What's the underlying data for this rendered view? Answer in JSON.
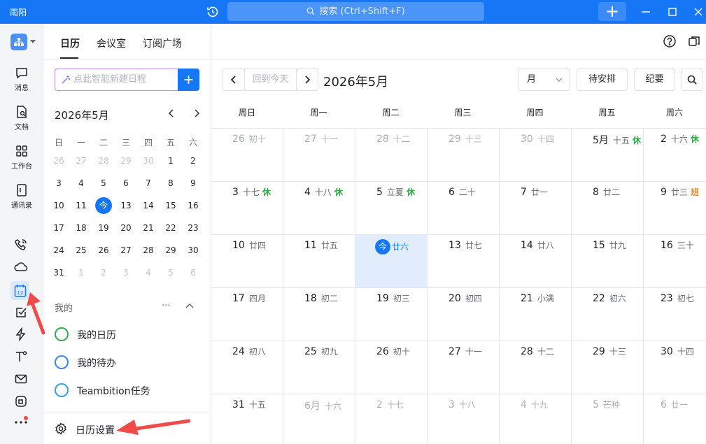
{
  "titlebar": {
    "app_name": "雨阳",
    "search_placeholder": "搜索 (Ctrl+Shift+F)"
  },
  "rail": {
    "items": [
      {
        "label": "消息",
        "icon": "chat-icon"
      },
      {
        "label": "文档",
        "icon": "doc-icon"
      },
      {
        "label": "工作台",
        "icon": "grid-icon"
      },
      {
        "label": "通讯录",
        "icon": "contacts-icon"
      }
    ],
    "calendar_icon_text": "12"
  },
  "tabs": [
    "日历",
    "会议室",
    "订阅广场"
  ],
  "smart_input_placeholder": "点此智能新建日程",
  "mini_calendar": {
    "title": "2026年5月",
    "weekdays": [
      "日",
      "一",
      "二",
      "三",
      "四",
      "五",
      "六"
    ],
    "weeks": [
      [
        "26",
        "27",
        "28",
        "29",
        "30",
        "1",
        "2"
      ],
      [
        "3",
        "4",
        "5",
        "6",
        "7",
        "8",
        "9"
      ],
      [
        "10",
        "11",
        "今",
        "13",
        "14",
        "15",
        "16"
      ],
      [
        "17",
        "18",
        "19",
        "20",
        "21",
        "22",
        "23"
      ],
      [
        "24",
        "25",
        "26",
        "27",
        "28",
        "29",
        "30"
      ],
      [
        "31",
        "1",
        "2",
        "3",
        "4",
        "5",
        "6"
      ]
    ]
  },
  "my_section": {
    "title": "我的",
    "more": "···",
    "calendars": [
      {
        "label": "我的日历",
        "color": "#34a853"
      },
      {
        "label": "我的待办",
        "color": "#3b82f6"
      },
      {
        "label": "Teambition任务",
        "color": "#3b9ddf"
      }
    ]
  },
  "settings_label": "日历设置",
  "toolbar": {
    "back_today": "回到今天",
    "title": "2026年5月",
    "view_select": "月",
    "pending": "待安排",
    "memo": "纪要"
  },
  "month": {
    "weekdays": [
      "周日",
      "周一",
      "周二",
      "周三",
      "周四",
      "周五",
      "周六"
    ],
    "weeks": [
      [
        {
          "n": "26",
          "l": "初十",
          "dim": true
        },
        {
          "n": "27",
          "l": "十一",
          "dim": true
        },
        {
          "n": "28",
          "l": "十二",
          "dim": true
        },
        {
          "n": "29",
          "l": "十三",
          "dim": true
        },
        {
          "n": "30",
          "l": "十四",
          "dim": true
        },
        {
          "n": "5月",
          "l": "十五",
          "tag": "休",
          "tagType": "rest"
        },
        {
          "n": "2",
          "l": "十六",
          "tag": "休",
          "tagType": "rest"
        }
      ],
      [
        {
          "n": "3",
          "l": "十七",
          "tag": "休",
          "tagType": "rest"
        },
        {
          "n": "4",
          "l": "十八",
          "tag": "休",
          "tagType": "rest"
        },
        {
          "n": "5",
          "l": "立夏",
          "tag": "休",
          "tagType": "rest"
        },
        {
          "n": "6",
          "l": "二十"
        },
        {
          "n": "7",
          "l": "廿一"
        },
        {
          "n": "8",
          "l": "廿二"
        },
        {
          "n": "9",
          "l": "廿三",
          "tag": "班",
          "tagType": "work"
        }
      ],
      [
        {
          "n": "10",
          "l": "廿四"
        },
        {
          "n": "11",
          "l": "廿五"
        },
        {
          "n": "今",
          "l": "廿六",
          "today": true
        },
        {
          "n": "13",
          "l": "廿七"
        },
        {
          "n": "14",
          "l": "廿八"
        },
        {
          "n": "15",
          "l": "廿九"
        },
        {
          "n": "16",
          "l": "三十"
        }
      ],
      [
        {
          "n": "17",
          "l": "四月"
        },
        {
          "n": "18",
          "l": "初二"
        },
        {
          "n": "19",
          "l": "初三"
        },
        {
          "n": "20",
          "l": "初四"
        },
        {
          "n": "21",
          "l": "小满"
        },
        {
          "n": "22",
          "l": "初六"
        },
        {
          "n": "23",
          "l": "初七"
        }
      ],
      [
        {
          "n": "24",
          "l": "初八"
        },
        {
          "n": "25",
          "l": "初九"
        },
        {
          "n": "26",
          "l": "初十"
        },
        {
          "n": "27",
          "l": "十一"
        },
        {
          "n": "28",
          "l": "十二"
        },
        {
          "n": "29",
          "l": "十三"
        },
        {
          "n": "30",
          "l": "十四"
        }
      ],
      [
        {
          "n": "31",
          "l": "十五"
        },
        {
          "n": "6月",
          "l": "十六",
          "dim": true
        },
        {
          "n": "2",
          "l": "十七",
          "dim": true
        },
        {
          "n": "3",
          "l": "十八",
          "dim": true
        },
        {
          "n": "4",
          "l": "十九",
          "dim": true
        },
        {
          "n": "5",
          "l": "芒种",
          "dim": true
        },
        {
          "n": "6",
          "l": "廿一",
          "dim": true
        }
      ]
    ]
  },
  "colors": {
    "brand": "#1677f6",
    "rest": "#32a645",
    "work": "#f08a24",
    "annotation": "#f04b4b"
  }
}
